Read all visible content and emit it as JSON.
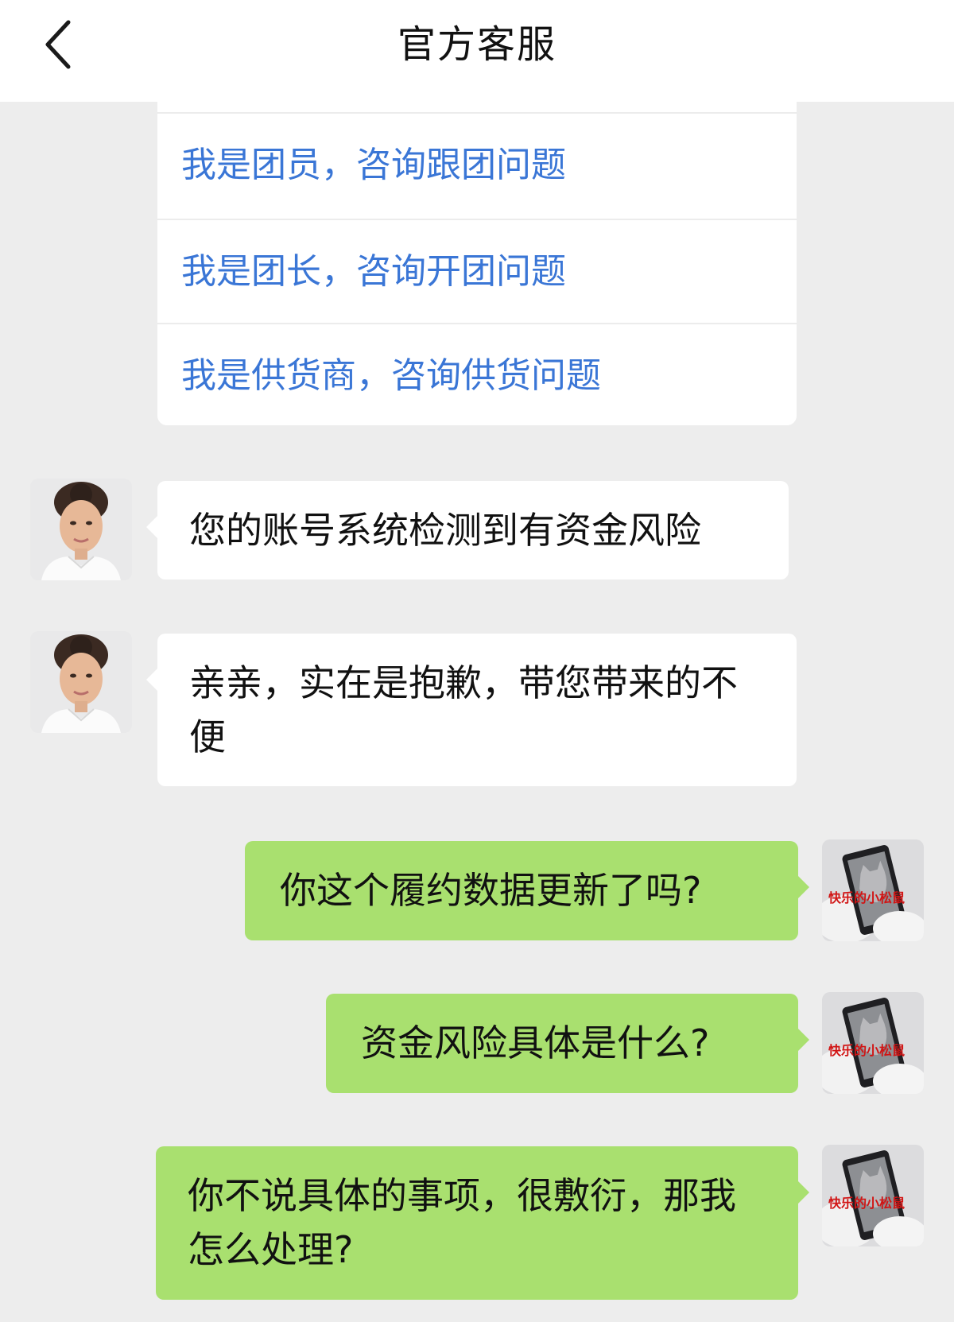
{
  "header": {
    "title": "官方客服",
    "back_icon": "chevron-left-icon"
  },
  "menu": {
    "items": [
      {
        "label": "我是团员，咨询跟团问题"
      },
      {
        "label": "我是团长，咨询开团问题"
      },
      {
        "label": "我是供货商，咨询供货问题"
      }
    ]
  },
  "messages": [
    {
      "side": "agent",
      "text": "您的账号系统检测到有资金风险"
    },
    {
      "side": "agent",
      "text": "亲亲，实在是抱歉，带您带来的不便"
    },
    {
      "side": "user",
      "text": "你这个履约数据更新了吗?"
    },
    {
      "side": "user",
      "text": "资金风险具体是什么?"
    },
    {
      "side": "user",
      "text": "你不说具体的事项，很敷衍，那我怎么处理?"
    }
  ],
  "user_avatar": {
    "caption": "快乐的小松鼠"
  },
  "colors": {
    "background": "#ededed",
    "link_blue": "#3a76d6",
    "user_bubble": "#a9e06f",
    "agent_bubble": "#ffffff"
  }
}
